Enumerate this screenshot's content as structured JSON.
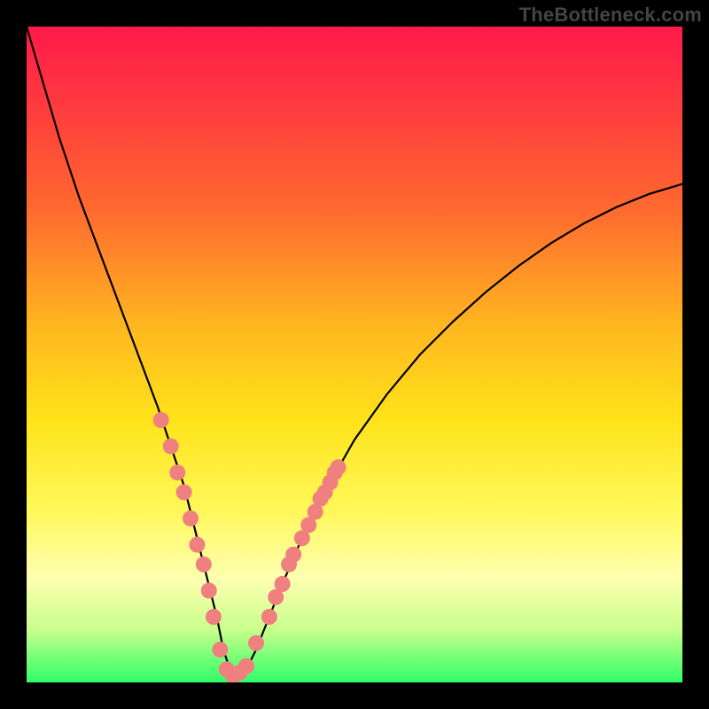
{
  "watermark": "TheBottleneck.com",
  "chart_data": {
    "type": "line",
    "title": "",
    "xlabel": "",
    "ylabel": "",
    "xlim": [
      0,
      100
    ],
    "ylim": [
      0,
      100
    ],
    "series": [
      {
        "name": "bottleneck-curve",
        "x": [
          0,
          5,
          8,
          11,
          14,
          17,
          20,
          22,
          24,
          26,
          27.5,
          29,
          30,
          31,
          32,
          33.5,
          35,
          37,
          39,
          42,
          46,
          50,
          55,
          60,
          65,
          70,
          75,
          80,
          85,
          90,
          95,
          100
        ],
        "y": [
          100,
          83,
          74,
          66,
          58,
          50,
          42,
          36,
          30,
          22,
          16,
          10,
          5,
          2,
          1,
          2,
          5,
          10,
          15,
          22,
          30,
          37,
          44,
          50,
          55,
          59.5,
          63.5,
          67,
          70,
          72.5,
          74.5,
          76
        ]
      }
    ],
    "markers": {
      "name": "highlight-points",
      "color": "#f08080",
      "radius": 9,
      "points": [
        {
          "x": 20.5,
          "y": 40
        },
        {
          "x": 22,
          "y": 36
        },
        {
          "x": 23,
          "y": 32
        },
        {
          "x": 24,
          "y": 29
        },
        {
          "x": 25,
          "y": 25
        },
        {
          "x": 26,
          "y": 21
        },
        {
          "x": 27,
          "y": 18
        },
        {
          "x": 27.8,
          "y": 14
        },
        {
          "x": 28.5,
          "y": 10
        },
        {
          "x": 29.5,
          "y": 5
        },
        {
          "x": 30.5,
          "y": 2
        },
        {
          "x": 31.5,
          "y": 1
        },
        {
          "x": 32.5,
          "y": 1.5
        },
        {
          "x": 33.5,
          "y": 2.5
        },
        {
          "x": 35,
          "y": 6
        },
        {
          "x": 37,
          "y": 10
        },
        {
          "x": 38,
          "y": 13
        },
        {
          "x": 39,
          "y": 15
        },
        {
          "x": 40,
          "y": 18
        },
        {
          "x": 40.7,
          "y": 19.5
        },
        {
          "x": 42,
          "y": 22
        },
        {
          "x": 43,
          "y": 24
        },
        {
          "x": 44,
          "y": 26
        },
        {
          "x": 44.8,
          "y": 28
        },
        {
          "x": 45.5,
          "y": 29
        },
        {
          "x": 46.3,
          "y": 30.5
        },
        {
          "x": 47,
          "y": 32
        },
        {
          "x": 47.5,
          "y": 32.8
        }
      ]
    }
  }
}
